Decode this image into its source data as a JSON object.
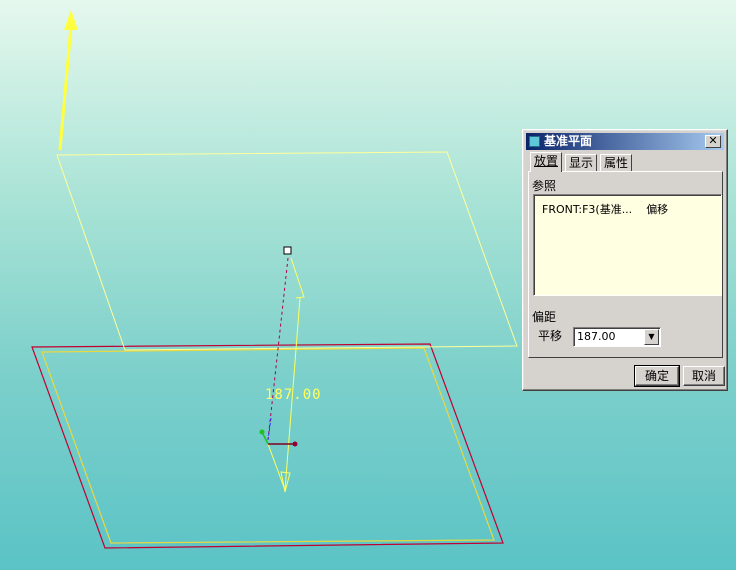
{
  "viewport": {
    "dimension_label": "187.00",
    "colors": {
      "datum_plane": "#ffff80",
      "existing_plane": "#c00030",
      "arrow": "#ffff40"
    }
  },
  "dialog": {
    "title": "基准平面",
    "close_glyph": "✕",
    "tabs": [
      {
        "label": "放置",
        "active": true
      },
      {
        "label": "显示",
        "active": false
      },
      {
        "label": "属性",
        "active": false
      }
    ],
    "references_label": "参照",
    "references": [
      {
        "name": "FRONT:F3(基准...",
        "type": "偏移"
      }
    ],
    "offset_section_label": "偏距",
    "offset_type_label": "平移",
    "offset_value": "187.00",
    "ok_label": "确定",
    "cancel_label": "取消"
  }
}
